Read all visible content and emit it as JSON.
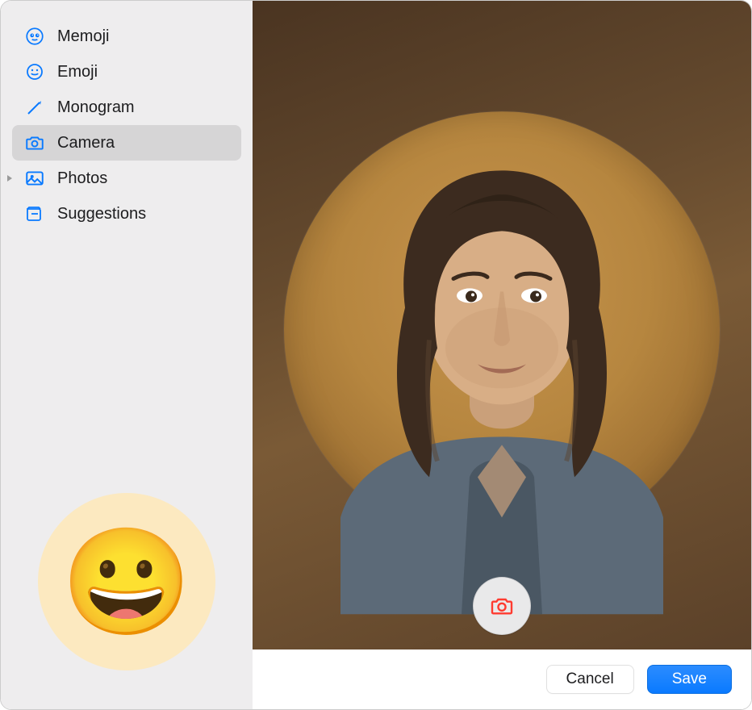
{
  "sidebar": {
    "items": [
      {
        "label": "Memoji",
        "icon": "memoji-icon",
        "selected": false,
        "hasDisclosure": false
      },
      {
        "label": "Emoji",
        "icon": "emoji-icon",
        "selected": false,
        "hasDisclosure": false
      },
      {
        "label": "Monogram",
        "icon": "monogram-icon",
        "selected": false,
        "hasDisclosure": false
      },
      {
        "label": "Camera",
        "icon": "camera-icon",
        "selected": true,
        "hasDisclosure": false
      },
      {
        "label": "Photos",
        "icon": "photos-icon",
        "selected": false,
        "hasDisclosure": true
      },
      {
        "label": "Suggestions",
        "icon": "suggestions-icon",
        "selected": false,
        "hasDisclosure": false
      }
    ],
    "preview_emoji": "😀"
  },
  "footer": {
    "cancel_label": "Cancel",
    "save_label": "Save"
  },
  "capture": {
    "icon_name": "camera-capture-icon"
  }
}
